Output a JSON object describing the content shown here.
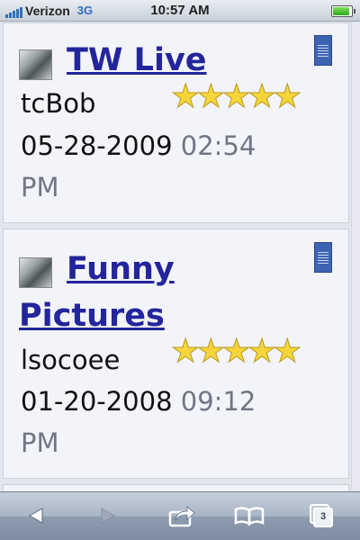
{
  "status_bar": {
    "carrier": "Verizon",
    "network": "3G",
    "time": "10:57 AM",
    "battery_level": 1.0
  },
  "items": [
    {
      "title": "TW Live",
      "user": "tcBob",
      "date": "05-28-2009",
      "time": "02:54",
      "ampm": "PM",
      "rating": 5
    },
    {
      "title_line1": "Funny",
      "title_line2": "Pictures",
      "user": "lsocoee",
      "date": "01-20-2008",
      "time": "09:12",
      "ampm": "PM",
      "rating": 5
    }
  ],
  "toolbar": {
    "tabs_count": "3",
    "icons": [
      "back-icon",
      "forward-icon",
      "share-icon",
      "bookmarks-icon",
      "pages-icon"
    ]
  },
  "colors": {
    "link": "#23259c",
    "star": "#f5d53a",
    "time_gray": "#717685",
    "card_bg": "#f3f4fa"
  }
}
